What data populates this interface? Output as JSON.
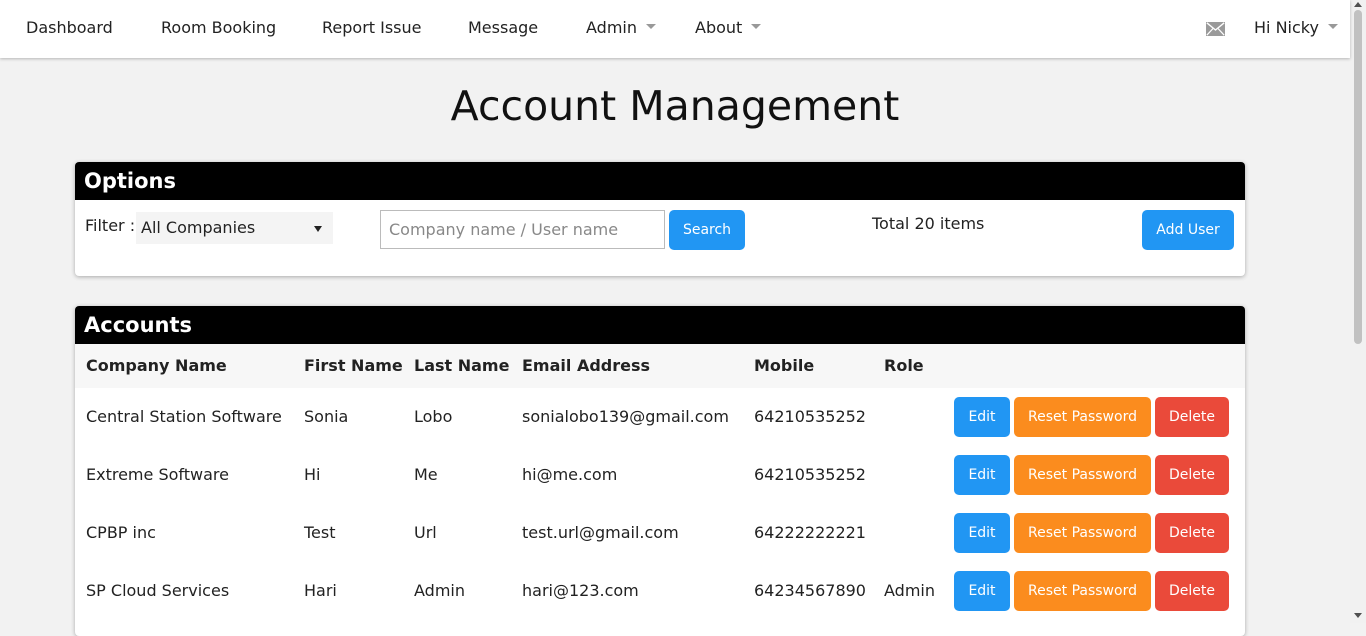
{
  "nav": {
    "items": [
      "Dashboard",
      "Room Booking",
      "Report Issue",
      "Message",
      "Admin",
      "About"
    ],
    "user_greeting": "Hi Nicky"
  },
  "page": {
    "title": "Account Management"
  },
  "options": {
    "heading": "Options",
    "filter_label": "Filter :",
    "filter_selected": "All Companies",
    "search_placeholder": "Company name / User name",
    "search_label": "Search",
    "total_text": "Total 20 items",
    "add_user_label": "Add User"
  },
  "accounts": {
    "heading": "Accounts",
    "columns": [
      "Company Name",
      "First Name",
      "Last Name",
      "Email Address",
      "Mobile",
      "Role"
    ],
    "rows": [
      [
        "Central Station Software",
        "Sonia",
        "Lobo",
        "sonialobo139@gmail.com",
        "64210535252",
        ""
      ],
      [
        "Extreme Software",
        "Hi",
        "Me",
        "hi@me.com",
        "64210535252",
        ""
      ],
      [
        "CPBP inc",
        "Test",
        "Url",
        "test.url@gmail.com",
        "64222222221",
        ""
      ],
      [
        "SP Cloud Services",
        "Hari",
        "Admin",
        "hari@123.com",
        "64234567890",
        "Admin"
      ]
    ],
    "edit_label": "Edit",
    "reset_label": "Reset Password",
    "delete_label": "Delete"
  },
  "colors": {
    "primary": "#2196f3",
    "warning": "#fb8c1e",
    "danger": "#ea4a3a",
    "panel_header": "#000000"
  },
  "icons": {
    "mail": "envelope-icon",
    "dropdown": "caret-down-icon"
  }
}
